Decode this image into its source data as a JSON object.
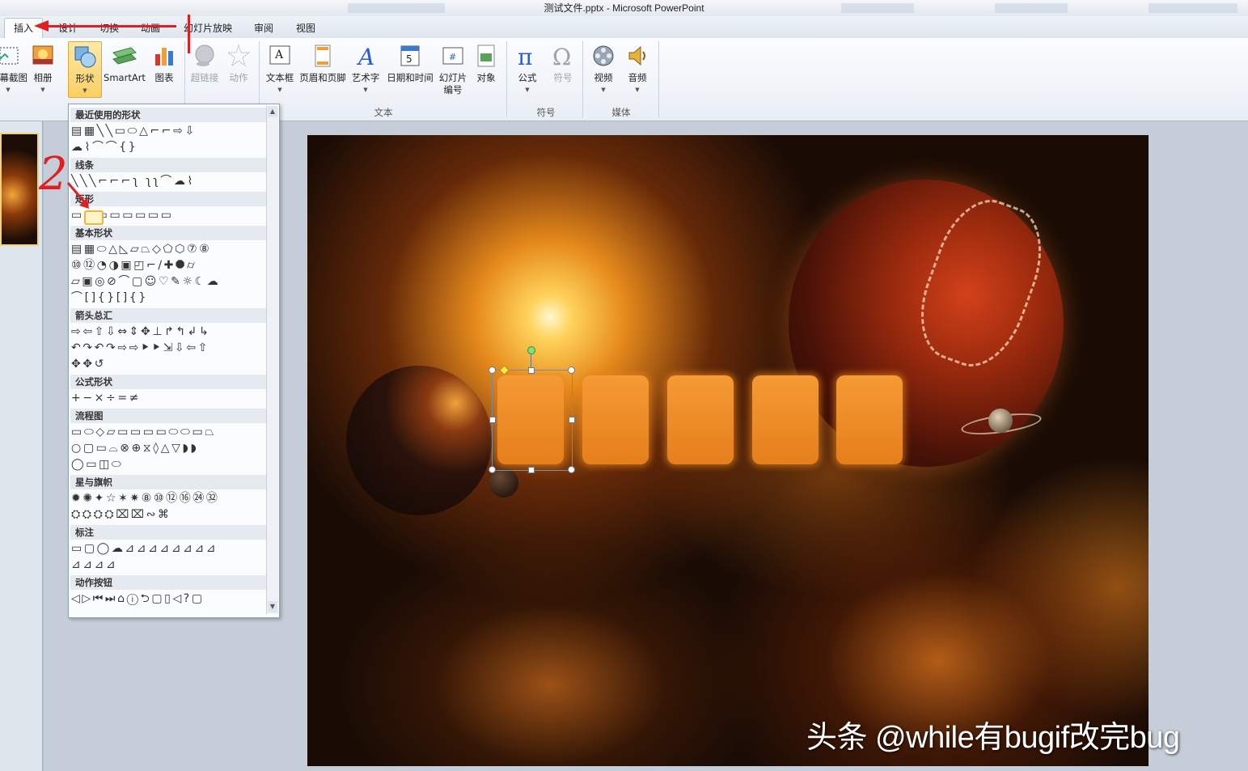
{
  "window": {
    "title": "测试文件.pptx  -  Microsoft PowerPoint"
  },
  "tabs": [
    {
      "label": "插入",
      "active": true
    },
    {
      "label": "设计"
    },
    {
      "label": "切换"
    },
    {
      "label": "动画"
    },
    {
      "label": "幻灯片放映"
    },
    {
      "label": "审阅"
    },
    {
      "label": "视图"
    }
  ],
  "ribbon": {
    "buttons": {
      "screenshot": "屏幕截图",
      "album": "相册",
      "shapes": "形状",
      "smartart": "SmartArt",
      "chart": "图表",
      "hyperlink": "超链接",
      "action": "动作",
      "textbox": "文本框",
      "header_footer": "页眉和页脚",
      "wordart": "艺术字",
      "datetime": "日期和时间",
      "slide_number_1": "幻灯片",
      "slide_number_2": "编号",
      "object": "对象",
      "equation": "公式",
      "symbol": "符号",
      "video": "视频",
      "audio": "音频"
    },
    "groups": {
      "text": "文本",
      "symbols": "符号",
      "media": "媒体"
    }
  },
  "shapes_gallery": {
    "sections": {
      "recent": "最近使用的形状",
      "lines": "线条",
      "rectangles": "矩形",
      "basic": "基本形状",
      "arrows": "箭头总汇",
      "equation": "公式形状",
      "flowchart": "流程图",
      "stars": "星与旗帜",
      "callouts": "标注",
      "action_buttons": "动作按钮"
    },
    "glyph_rows": {
      "recent_1": "▤▦╲╲▭⬭△⌐⌐⇨⇩",
      "recent_2": "☁⌇⌒⌒{}",
      "lines_1": "╲╲╲⌐⌐⌐ʅ ʅʅ⌒☁⌇",
      "rect_1": "▭▢▭▭▭▭▭▭",
      "basic_1": "▤▦⬭△◺▱⏢◇⬠⬡⑦⑧",
      "basic_2": "⑩⑫◔◑▣◰⌐∕✚⯃⌭",
      "basic_3": "▱▣◎⊘⌒▢☺♡✎☼☾☁",
      "basic_4": "⌒[]{}[]{}",
      "arrows_1": "⇨⇦⇧⇩⇔⇕✥⊥↱↰↲↳",
      "arrows_2": "↶↷↶↷⇨⇨⯈⯈⇲⇩⇦⇧",
      "arrows_3": "✥✥↺",
      "equation_1": "+−×÷=≠",
      "flow_1": "▭⬭◇▱▭▭▭▭⬭⬭▭⏢",
      "flow_2": "○▢▭⌓⊗⊕⧖◊△▽◗◗",
      "flow_3": "◯▭◫⬭",
      "stars_1": "✹✺✦☆✶✷⑧⑩⑫⑯㉔㉜",
      "stars_2": "⛭⛭⛭⛭⌧⌧∾⌘",
      "callouts_1": "▭▢◯☁⊿⊿⊿⊿⊿⊿⊿⊿",
      "callouts_2": "⊿⊿⊿⊿",
      "actions_1": "◁▷⏮⏭⌂ⓘ⮌▢▯◁?▢"
    }
  },
  "slide": {
    "box_color": "#F28F2A",
    "box_count": 5
  },
  "watermark": "头条 @while有bugif改完bug",
  "annotation": {
    "step_number": "2"
  }
}
